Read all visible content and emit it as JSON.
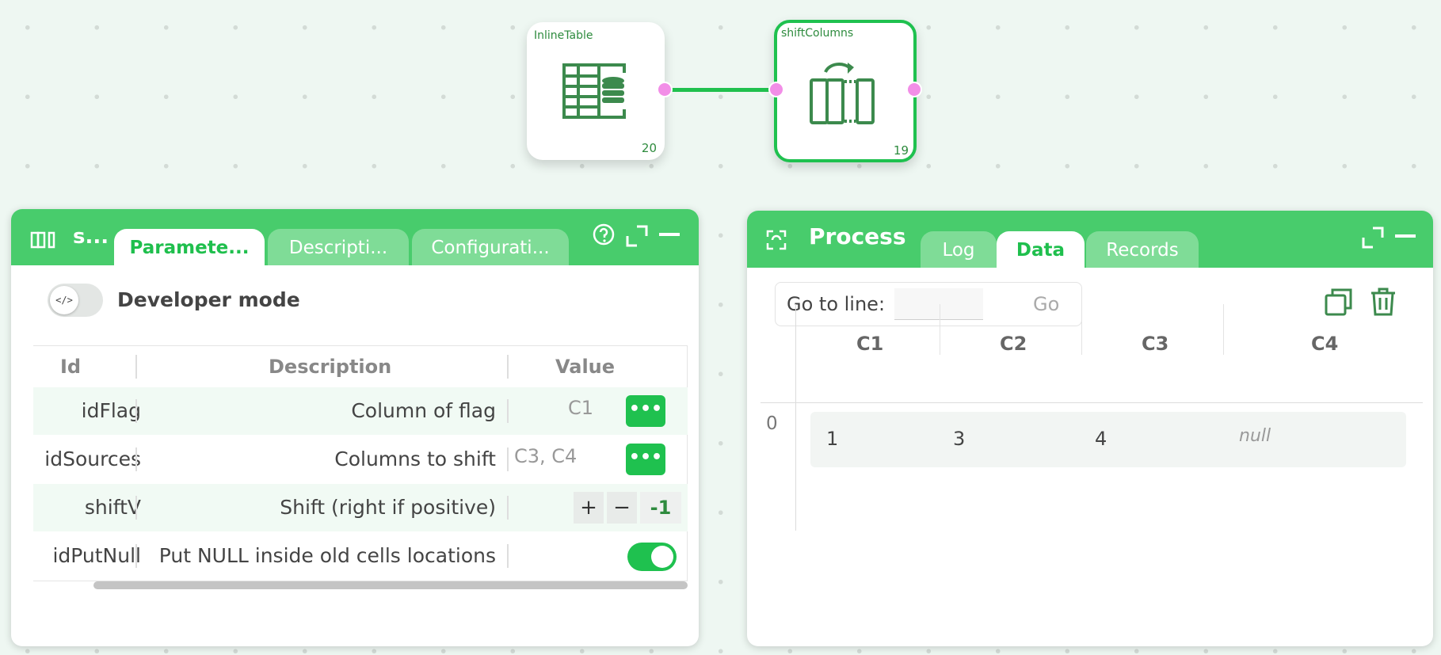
{
  "graph": {
    "nodes": [
      {
        "title": "InlineTable",
        "count": "20",
        "icon": "inline-table-icon"
      },
      {
        "title": "shiftColumns",
        "count": "19",
        "icon": "shift-columns-icon",
        "selected": true
      }
    ],
    "colors": {
      "accent": "#1fc14f",
      "header": "#48cc6c",
      "tab_inactive": "#7fdc97",
      "port": "#f28ee7"
    }
  },
  "params_panel": {
    "title": "s...",
    "tabs": [
      {
        "label": "Paramete...",
        "active": true
      },
      {
        "label": "Descripti...",
        "active": false
      },
      {
        "label": "Configurati...",
        "active": false
      }
    ],
    "developer_mode": {
      "label": "Developer mode",
      "enabled": false,
      "icon_text": "</>"
    },
    "table": {
      "columns": [
        "Id",
        "Description",
        "Value"
      ],
      "rows": [
        {
          "id": "idFlag",
          "description": "Column of flag",
          "value": "C1",
          "editor": "dots"
        },
        {
          "id": "idSources",
          "description": "Columns to shift",
          "value": "C3, C4",
          "editor": "dots"
        },
        {
          "id": "shiftV",
          "description": "Shift (right if positive)",
          "value": "-1",
          "editor": "stepper",
          "plus": "+",
          "minus": "−"
        },
        {
          "id": "idPutNull",
          "description": "Put NULL inside old cells locations",
          "value": true,
          "editor": "switch"
        }
      ],
      "dots_label": "•••"
    }
  },
  "process_panel": {
    "title": "Process",
    "tabs": [
      {
        "label": "Log",
        "active": false
      },
      {
        "label": "Data",
        "active": true
      },
      {
        "label": "Records",
        "active": false
      }
    ],
    "goto": {
      "label": "Go to line:",
      "value": "",
      "button": "Go"
    },
    "data_table": {
      "columns": [
        "C1",
        "C2",
        "C3",
        "C4"
      ],
      "rows": [
        {
          "index": "0",
          "cells": [
            "1",
            "3",
            "4",
            "null"
          ]
        }
      ]
    }
  }
}
